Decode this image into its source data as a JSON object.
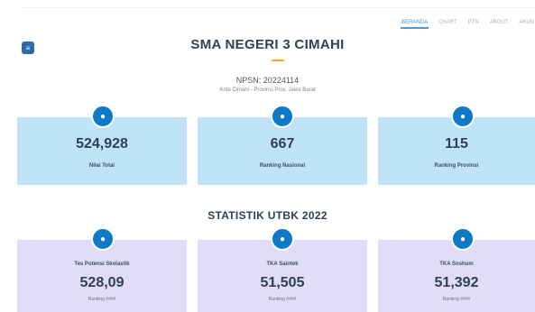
{
  "nav": {
    "items": [
      "BERANDA",
      "CHART",
      "PTN",
      "ABOUT",
      "AKUN"
    ],
    "active_index": 0
  },
  "menu_button": {
    "icon": "menu-icon",
    "glyph": "≡"
  },
  "school": {
    "name": "SMA NEGERI 3 CIMAHI",
    "npsn": "NPSN: 20224114",
    "location": "Kota Cimahi - Provinsi Prov. Jawa Barat"
  },
  "summary_cards": [
    {
      "icon": "trophy-icon",
      "glyph": "●",
      "value": "524,928",
      "label": "Nilai Total"
    },
    {
      "icon": "ranking-icon",
      "glyph": "●",
      "value": "667",
      "label": "Ranking Nasional"
    },
    {
      "icon": "ranking-icon",
      "glyph": "●",
      "value": "115",
      "label": "Ranking Provinsi"
    }
  ],
  "utbk": {
    "title": "STATISTIK UTBK 2022",
    "cards": [
      {
        "icon": "chart-icon",
        "glyph": "●",
        "label": "Tes Potensi Skolastik",
        "value": "528,09",
        "sub": "Ranking #### "
      },
      {
        "icon": "book-icon",
        "glyph": "●",
        "label": "TKA Saintek",
        "value": "51,505",
        "sub": "Ranking ####"
      },
      {
        "icon": "book-icon",
        "glyph": "●",
        "label": "TKA Soshum",
        "value": "51,392",
        "sub": "Ranking ####"
      }
    ]
  },
  "colors": {
    "accent": "#f5a623",
    "badge": "#0d79c7",
    "card_blue": "#bfe3f7",
    "card_lavender": "#e1dcf7",
    "brand": "#2e6aa8"
  }
}
